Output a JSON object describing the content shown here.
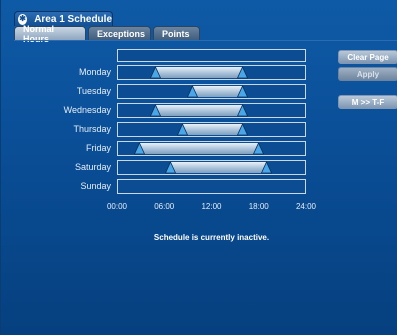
{
  "window": {
    "title": "Area 1 Schedule",
    "icon": "app-badge-icon"
  },
  "tabs": [
    {
      "label": "Normal Hours",
      "active": true
    },
    {
      "label": "Exceptions",
      "active": false
    },
    {
      "label": "Points",
      "active": false
    }
  ],
  "schedule": {
    "days": [
      {
        "label": "Monday",
        "start": "04:45",
        "end": "16:00"
      },
      {
        "label": "Tuesday",
        "start": "09:30",
        "end": "16:00"
      },
      {
        "label": "Wednesday",
        "start": "04:45",
        "end": "16:00"
      },
      {
        "label": "Thursday",
        "start": "08:15",
        "end": "16:00"
      },
      {
        "label": "Friday",
        "start": "02:45",
        "end": "18:00"
      },
      {
        "label": "Saturday",
        "start": "06:45",
        "end": "19:00"
      },
      {
        "label": "Sunday",
        "start": null,
        "end": null
      }
    ],
    "axis_ticks": [
      "00:00",
      "06:00",
      "12:00",
      "18:00",
      "24:00"
    ],
    "status": "Schedule is currently inactive."
  },
  "buttons": {
    "clear_page": "Clear Page",
    "apply": "Apply",
    "copy_mon_to_weekdays": "M >> T-F"
  },
  "colors": {
    "background": "#0a4f98",
    "bar_light": "#e9f1f8",
    "handle": "#49a6e8"
  }
}
